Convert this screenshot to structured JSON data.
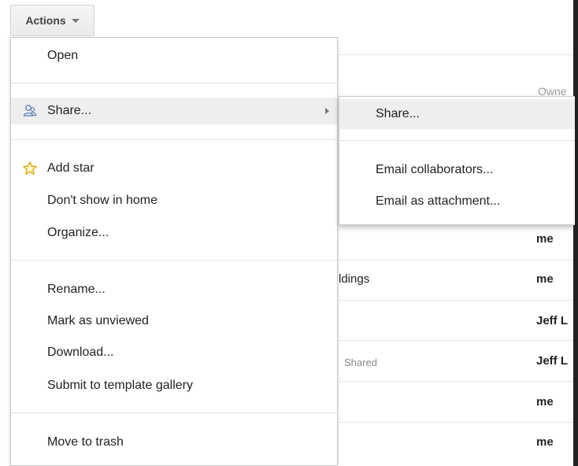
{
  "toolbar": {
    "actions_label": "Actions"
  },
  "background": {
    "owner_header": "Owne",
    "rows": [
      {
        "name": "",
        "owner": "me"
      },
      {
        "name": "ldings",
        "owner": "me"
      },
      {
        "name": "",
        "owner": "Jeff L"
      },
      {
        "name": "Shared",
        "owner": "Jeff L"
      },
      {
        "name": "",
        "owner": "me"
      },
      {
        "name": "",
        "owner": "me"
      }
    ]
  },
  "menu": {
    "open": "Open",
    "share": "Share...",
    "add_star": "Add star",
    "dont_show": "Don't show in home",
    "organize": "Organize...",
    "rename": "Rename...",
    "mark_unviewed": "Mark as unviewed",
    "download": "Download...",
    "submit_template": "Submit to template gallery",
    "move_trash": "Move to trash"
  },
  "submenu": {
    "share": "Share...",
    "email_collaborators": "Email collaborators...",
    "email_attachment": "Email as attachment..."
  },
  "icons": {
    "share": "share-people-icon",
    "star": "star-outline-icon"
  },
  "colors": {
    "hover": "#eeeeee",
    "star": "#f5c518",
    "share_icon": "#5a7fb8"
  }
}
